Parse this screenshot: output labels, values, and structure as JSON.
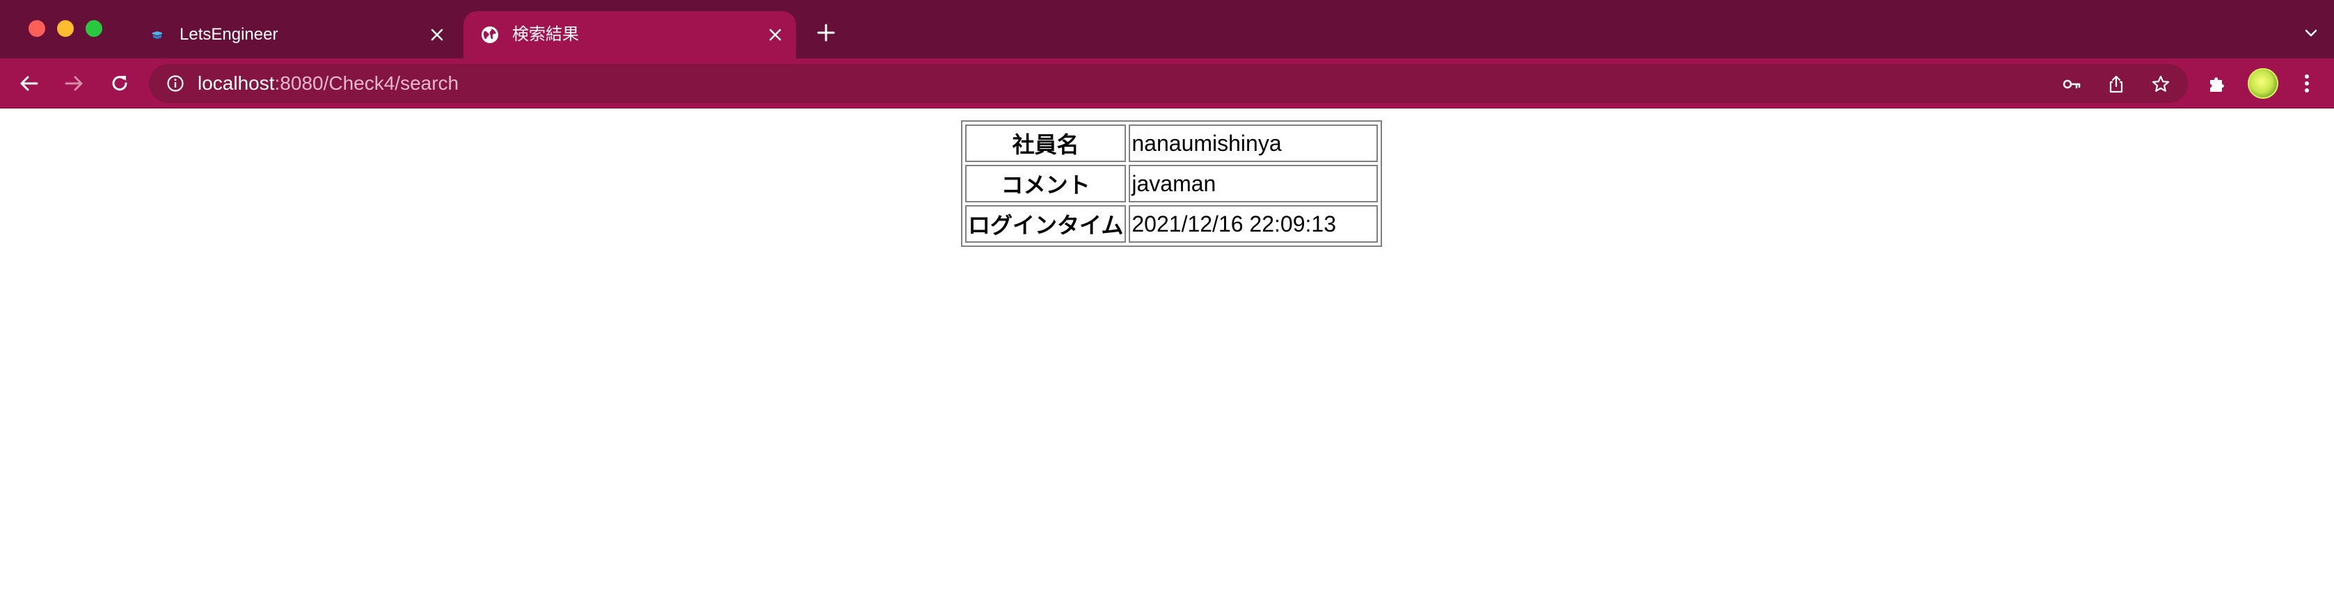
{
  "window": {
    "traffic_lights": [
      "close",
      "minimize",
      "maximize"
    ]
  },
  "tabs": [
    {
      "title": "LetsEngineer",
      "favicon": "letsengineer-favicon",
      "active": false
    },
    {
      "title": "検索結果",
      "favicon": "globe-icon",
      "active": true
    }
  ],
  "toolbar": {
    "url_host": "localhost",
    "url_rest": ":8080/Check4/search"
  },
  "colors": {
    "tabbar": "#660f38",
    "toolbar": "#a0134f",
    "omnibox": "#841441"
  },
  "result_table": {
    "rows": [
      {
        "label": "社員名",
        "value": "nanaumishinya"
      },
      {
        "label": "コメント",
        "value": "javaman"
      },
      {
        "label": "ログインタイム",
        "value": "2021/12/16 22:09:13"
      }
    ]
  }
}
